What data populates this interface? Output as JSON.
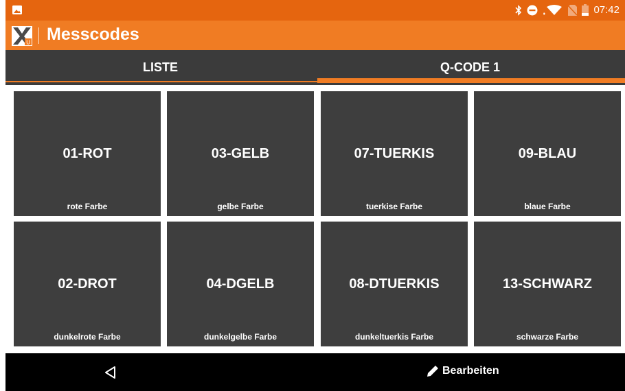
{
  "status_bar": {
    "time": "07:42",
    "icons": [
      "image-icon",
      "bluetooth-icon",
      "do-not-disturb-icon",
      "wifi-icon",
      "no-sim-icon",
      "battery-icon"
    ]
  },
  "app_bar": {
    "title": "Messcodes",
    "logo_icon": "app-logo-icon",
    "colors": {
      "status": "#e5650f",
      "bar": "#f07c23"
    }
  },
  "tabs": [
    {
      "label": "LISTE",
      "selected": false
    },
    {
      "label": "Q-CODE 1",
      "selected": true
    }
  ],
  "tiles": [
    {
      "code": "01-ROT",
      "desc": "rote Farbe"
    },
    {
      "code": "03-GELB",
      "desc": "gelbe Farbe"
    },
    {
      "code": "07-TUERKIS",
      "desc": "tuerkise Farbe"
    },
    {
      "code": "09-BLAU",
      "desc": "blaue Farbe"
    },
    {
      "code": "02-DROT",
      "desc": "dunkelrote Farbe"
    },
    {
      "code": "04-DGELB",
      "desc": "dunkelgelbe Farbe"
    },
    {
      "code": "08-DTUERKIS",
      "desc": "dunkeltuerkis Farbe"
    },
    {
      "code": "13-SCHWARZ",
      "desc": "schwarze Farbe"
    }
  ],
  "bottom_bar": {
    "back_icon": "back-triangle-icon",
    "edit_icon": "pencil-icon",
    "edit_label": "Bearbeiten"
  }
}
